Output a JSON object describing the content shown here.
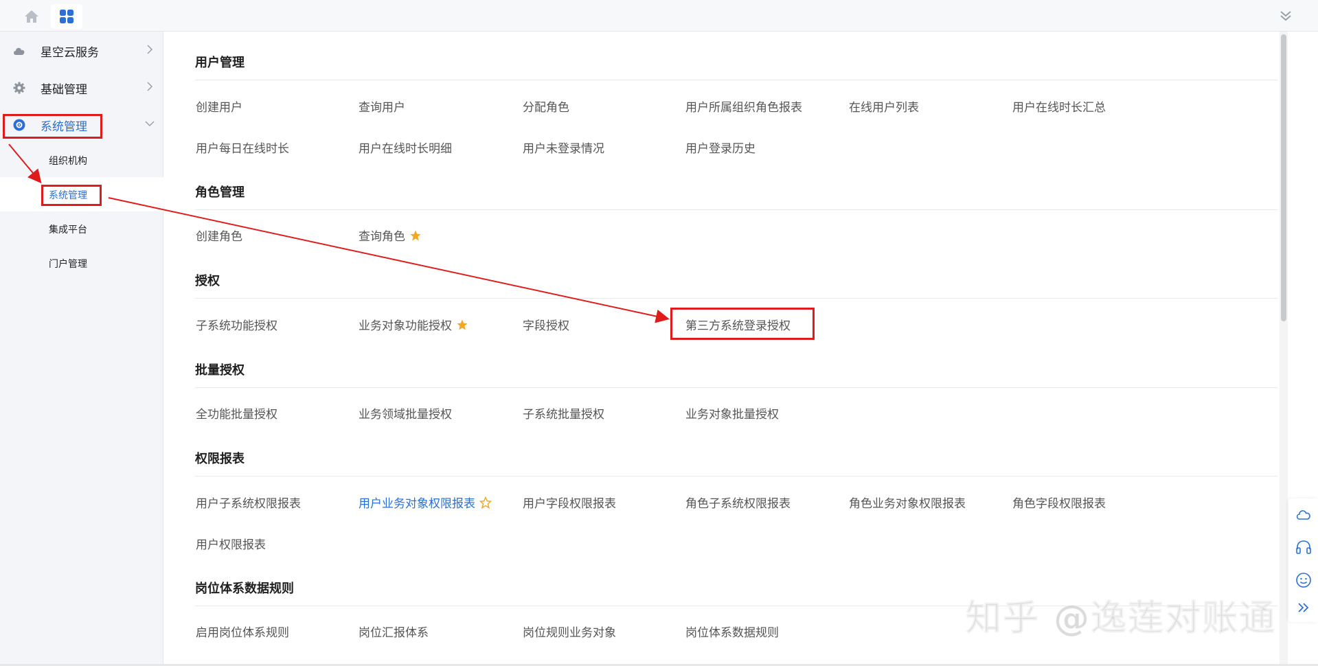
{
  "sidebar": {
    "items": [
      {
        "label": "星空云服务"
      },
      {
        "label": "基础管理"
      },
      {
        "label": "系统管理"
      }
    ],
    "subitems": [
      {
        "label": "组织机构"
      },
      {
        "label": "系统管理"
      },
      {
        "label": "集成平台"
      },
      {
        "label": "门户管理"
      }
    ]
  },
  "sections": [
    {
      "title": "用户管理",
      "links": [
        "创建用户",
        "查询用户",
        "分配角色",
        "用户所属组织角色报表",
        "在线用户列表",
        "用户在线时长汇总",
        "用户每日在线时长",
        "用户在线时长明细",
        "用户未登录情况",
        "用户登录历史"
      ]
    },
    {
      "title": "角色管理",
      "links": [
        "创建角色",
        "查询角色"
      ]
    },
    {
      "title": "授权",
      "links": [
        "子系统功能授权",
        "业务对象功能授权",
        "字段授权",
        "第三方系统登录授权"
      ]
    },
    {
      "title": "批量授权",
      "links": [
        "全功能批量授权",
        "业务领域批量授权",
        "子系统批量授权",
        "业务对象批量授权"
      ]
    },
    {
      "title": "权限报表",
      "links": [
        "用户子系统权限报表",
        "用户业务对象权限报表",
        "用户字段权限报表",
        "角色子系统权限报表",
        "角色业务对象权限报表",
        "角色字段权限报表",
        "用户权限报表"
      ]
    },
    {
      "title": "岗位体系数据规则",
      "links": [
        "启用岗位体系规则",
        "岗位汇报体系",
        "岗位规则业务对象",
        "岗位体系数据规则"
      ]
    }
  ],
  "watermark": "知乎 @逸莲对账通",
  "colors": {
    "accent": "#2b6fd6",
    "annotation": "#e01b1b",
    "star": "#f5a623"
  },
  "icons": {
    "home": "home-icon",
    "apps": "grid-apps-icon",
    "collapse": "double-chevron-down-icon",
    "cloud": "cloud-icon",
    "gear": "gear-icon",
    "system": "system-icon",
    "headset": "headset-icon",
    "smile": "smile-icon",
    "expand": "double-chevron-right-icon"
  }
}
